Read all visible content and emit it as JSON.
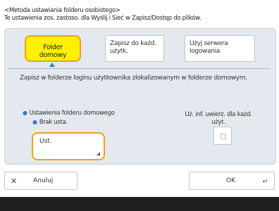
{
  "header": {
    "line1": "<Metoda ustawiania folderu osobistego>",
    "line2": "Te ustawienia zos. zastoso. dla Wyślij i Sieć w Zapisz/Dostęp do plików."
  },
  "options": [
    {
      "label": "Folder domowy",
      "selected": true
    },
    {
      "label": "Zapisz do kaźd. użytk.",
      "selected": false
    },
    {
      "label": "Użyj serwera logowania",
      "selected": false
    }
  ],
  "description": "Zapisz w folderze loginu użytkownika zlokalizowanym w folderze domowym.",
  "home_folder_setting": {
    "label": "Ustawienia folderu domowego",
    "value": "Brak usta."
  },
  "setup_button": {
    "label": "Ust."
  },
  "auth_info": {
    "label": "Uż. inf. uwierz. dla każd. użyt.",
    "checked": false
  },
  "bottom": {
    "cancel": "Anuluj",
    "ok": "OK"
  },
  "colors": {
    "selected_fill": "#fdf000",
    "focus_border": "#f0a020",
    "panel": "#e3e9ee",
    "accent": "#3a7ad0"
  }
}
